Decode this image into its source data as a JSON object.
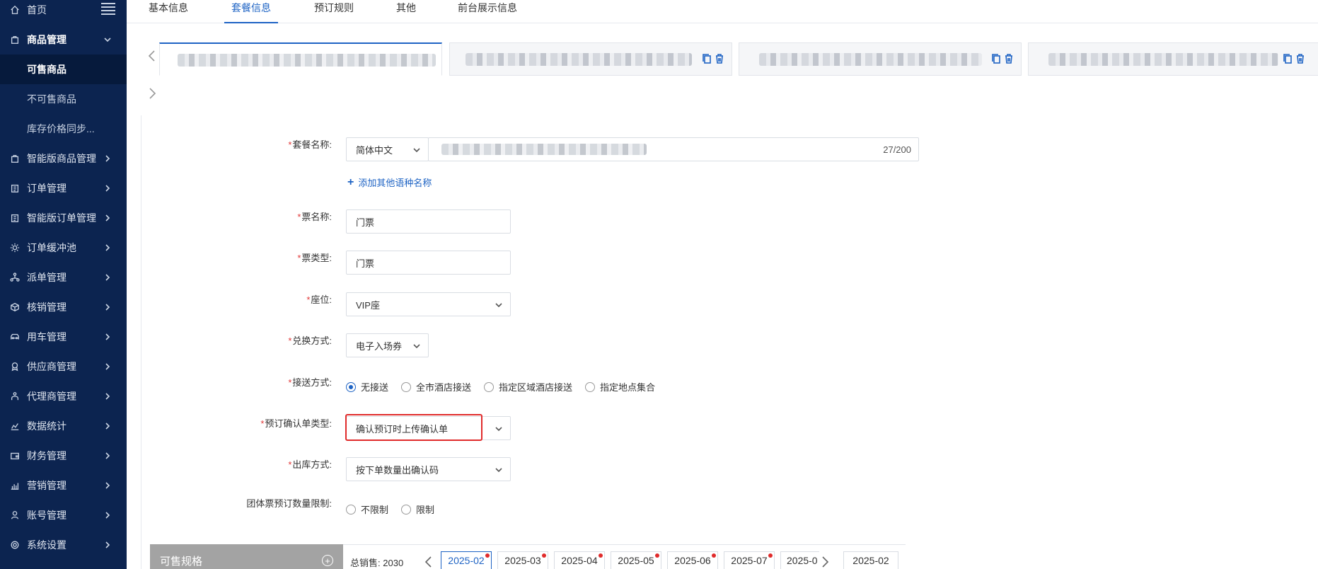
{
  "sidebar": {
    "home": "首页",
    "product_mgmt": "商品管理",
    "sub_items": [
      "可售商品",
      "不可售商品",
      "库存价格同步..."
    ],
    "items": [
      {
        "label": "智能版商品管理",
        "icon": "bag-icon"
      },
      {
        "label": "订单管理",
        "icon": "clipboard-icon"
      },
      {
        "label": "智能版订单管理",
        "icon": "clipboard-icon"
      },
      {
        "label": "订单缓冲池",
        "icon": "gear-icon"
      },
      {
        "label": "派单管理",
        "icon": "share-icon"
      },
      {
        "label": "核销管理",
        "icon": "cube-icon"
      },
      {
        "label": "用车管理",
        "icon": "car-icon"
      },
      {
        "label": "供应商管理",
        "icon": "badge-icon"
      },
      {
        "label": "代理商管理",
        "icon": "people-icon"
      },
      {
        "label": "数据统计",
        "icon": "chart-icon"
      },
      {
        "label": "财务管理",
        "icon": "wallet-icon"
      },
      {
        "label": "营销管理",
        "icon": "bar-chart-icon"
      },
      {
        "label": "账号管理",
        "icon": "user-icon"
      },
      {
        "label": "系统设置",
        "icon": "settings-icon"
      }
    ]
  },
  "top_tabs": [
    "基本信息",
    "套餐信息",
    "预订规则",
    "其他",
    "前台展示信息"
  ],
  "form": {
    "package_name_label": "套餐名称:",
    "language_select": "简体中文",
    "char_count": "27/200",
    "add_language": "添加其他语种名称",
    "ticket_name_label": "票名称:",
    "ticket_name_value": "门票",
    "ticket_type_label": "票类型:",
    "ticket_type_value": "门票",
    "seat_label": "座位:",
    "seat_value": "VIP座",
    "redeem_label": "兑换方式:",
    "redeem_value": "电子入场券",
    "pickup_label": "接送方式:",
    "pickup_options": [
      "无接送",
      "全市酒店接送",
      "指定区域酒店接送",
      "指定地点集合"
    ],
    "confirm_type_label": "预订确认单类型:",
    "confirm_type_value": "确认预订时上传确认单",
    "outbound_label": "出库方式:",
    "outbound_value": "按下单数量出确认码",
    "group_limit_label": "团体票预订数量限制:",
    "group_limit_options": [
      "不限制",
      "限制"
    ]
  },
  "specs": {
    "title": "可售规格",
    "total_label": "总销售:",
    "total_value": "2030",
    "months": [
      "2025-02",
      "2025-03",
      "2025-04",
      "2025-05",
      "2025-06",
      "2025-07",
      "2025-0"
    ],
    "month_picker": "2025-02"
  },
  "colors": {
    "sidebar": "#0c2450",
    "accent": "#1e63c4",
    "required": "#e23a3a",
    "highlight": "#e02b2b"
  }
}
